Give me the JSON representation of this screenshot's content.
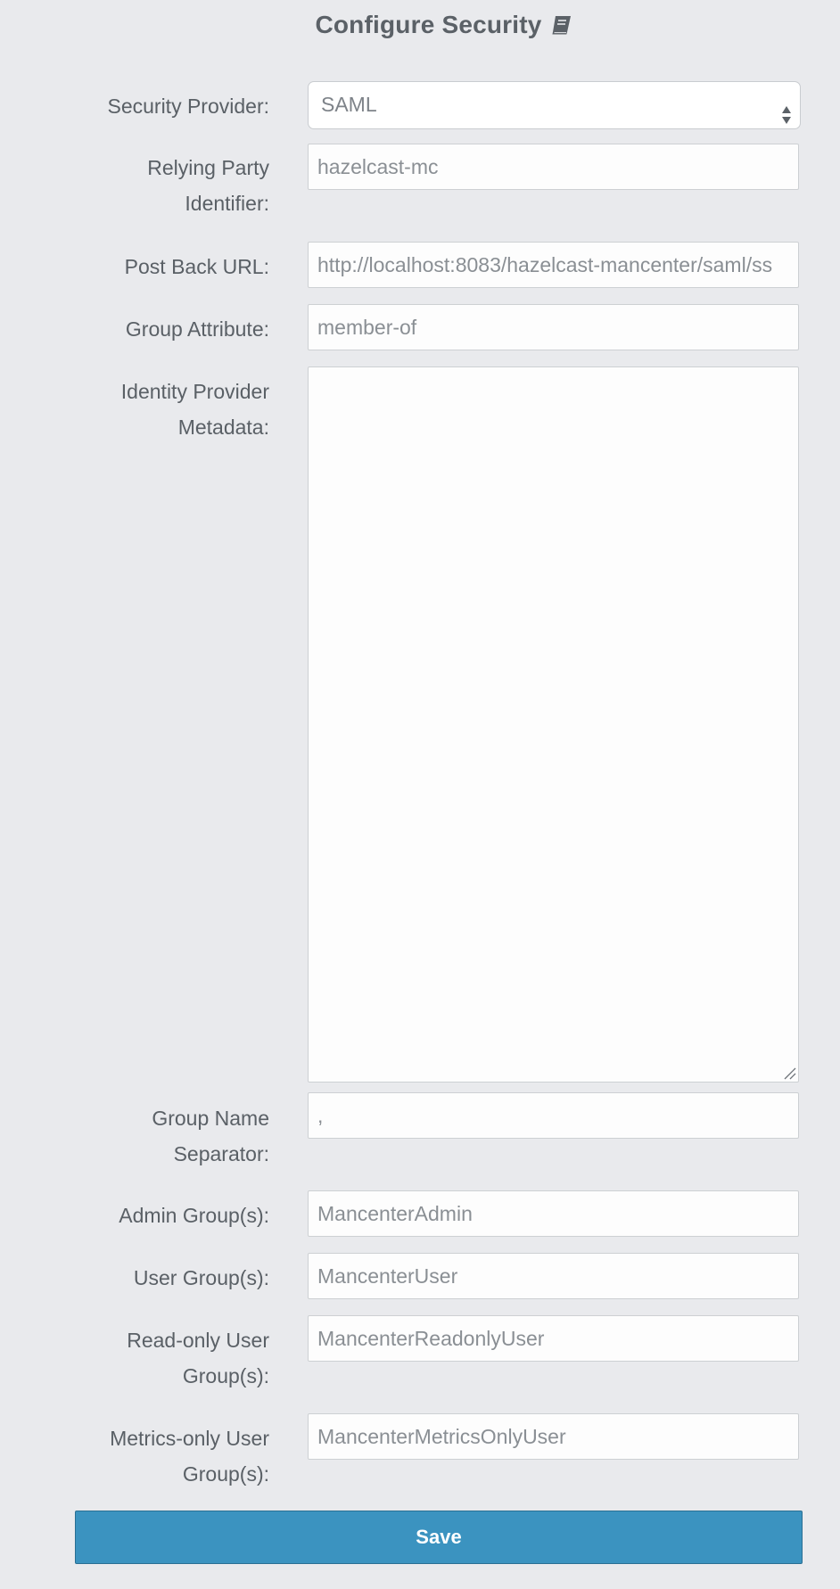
{
  "page": {
    "title": "Configure Security",
    "title_icon": "book-icon"
  },
  "form": {
    "security_provider": {
      "label": "Security Provider:",
      "value": "SAML"
    },
    "relying_party": {
      "label_line1": "Relying Party",
      "label_line2": "Identifier:",
      "value": "hazelcast-mc"
    },
    "post_back_url": {
      "label": "Post Back URL:",
      "value": "http://localhost:8083/hazelcast-mancenter/saml/ss"
    },
    "group_attribute": {
      "label": "Group Attribute:",
      "value": "member-of"
    },
    "idp_metadata": {
      "label_line1": "Identity Provider",
      "label_line2": "Metadata:",
      "value": ""
    },
    "group_name_separator": {
      "label_line1": "Group Name",
      "label_line2": "Separator:",
      "value": ","
    },
    "admin_groups": {
      "label": "Admin Group(s):",
      "value": "MancenterAdmin"
    },
    "user_groups": {
      "label": "User Group(s):",
      "value": "MancenterUser"
    },
    "readonly_groups": {
      "label_line1": "Read-only User",
      "label_line2": "Group(s):",
      "value": "MancenterReadonlyUser"
    },
    "metrics_groups": {
      "label_line1": "Metrics-only User",
      "label_line2": "Group(s):",
      "value": "MancenterMetricsOnlyUser"
    },
    "save_label": "Save"
  },
  "colors": {
    "background": "#e9eaed",
    "save_button": "#3b93c0",
    "label_text": "#5a6066",
    "field_text": "#8a8f94"
  }
}
